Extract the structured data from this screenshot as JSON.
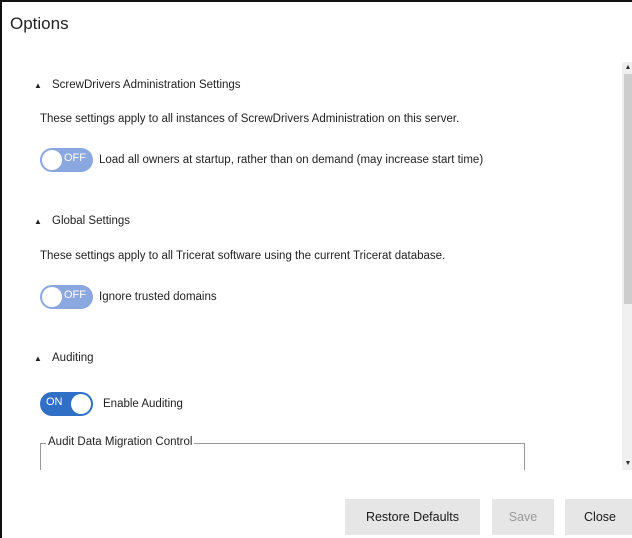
{
  "dialog": {
    "title": "Options"
  },
  "sections": [
    {
      "header": "ScrewDrivers Administration Settings",
      "description": "These settings apply to all instances of ScrewDrivers Administration on this server.",
      "toggle": {
        "state": "OFF",
        "label": "Load all owners at startup, rather than on demand (may increase start time)"
      }
    },
    {
      "header": "Global Settings",
      "description": "These settings apply to all Tricerat software using the current Tricerat database.",
      "toggle": {
        "state": "OFF",
        "label": "Ignore trusted domains"
      }
    },
    {
      "header": "Auditing",
      "toggle": {
        "state": "ON",
        "label": "Enable Auditing"
      },
      "group_box": {
        "label": "Audit Data Migration Control"
      }
    }
  ],
  "buttons": {
    "restore_defaults": "Restore Defaults",
    "save": "Save",
    "close": "Close"
  },
  "colors": {
    "toggle_off": "#8aa7e0",
    "toggle_on": "#2f6fc6",
    "button_bg": "#e6e6e6"
  }
}
